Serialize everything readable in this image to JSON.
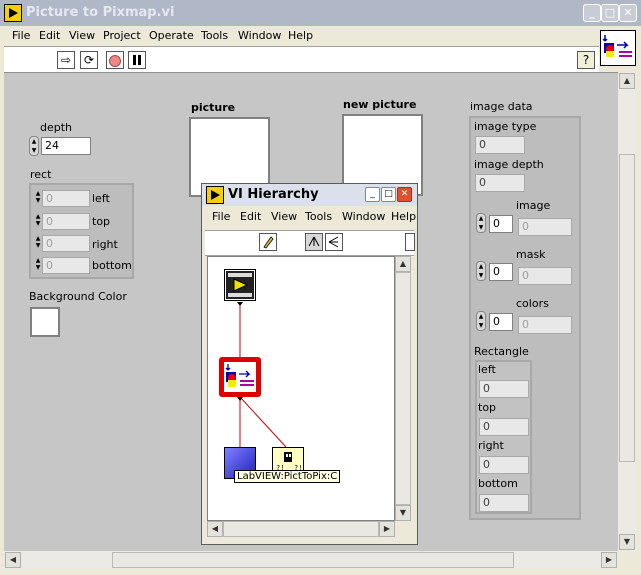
{
  "window": {
    "title": "Picture to Pixmap.vi",
    "minimize": "_",
    "maximize": "□",
    "close": "✕"
  },
  "menu": [
    "File",
    "Edit",
    "View",
    "Project",
    "Operate",
    "Tools",
    "Window",
    "Help"
  ],
  "toolbar": {
    "run": "⇨",
    "run_continuous": "⟳",
    "help": "?"
  },
  "front_panel": {
    "depth": {
      "label": "depth",
      "value": "24"
    },
    "rect": {
      "label": "rect",
      "fields": [
        {
          "label": "left",
          "value": "0"
        },
        {
          "label": "top",
          "value": "0"
        },
        {
          "label": "right",
          "value": "0"
        },
        {
          "label": "bottom",
          "value": "0"
        }
      ]
    },
    "background_color": {
      "label": "Background Color"
    },
    "picture": {
      "label": "picture"
    },
    "new_picture": {
      "label": "new picture"
    },
    "image_data": {
      "label": "image data",
      "image_type": {
        "label": "image type",
        "value": "0"
      },
      "image_depth": {
        "label": "image depth",
        "value": "0"
      },
      "image": {
        "label": "image",
        "index": "0",
        "value": "0"
      },
      "mask": {
        "label": "mask",
        "index": "0",
        "value": "0"
      },
      "colors": {
        "label": "colors",
        "index": "0",
        "value": "0"
      },
      "rectangle": {
        "label": "Rectangle",
        "fields": [
          {
            "label": "left",
            "value": "0"
          },
          {
            "label": "top",
            "value": "0"
          },
          {
            "label": "right",
            "value": "0"
          },
          {
            "label": "bottom",
            "value": "0"
          }
        ]
      }
    }
  },
  "hierarchy_window": {
    "title": "VI Hierarchy",
    "menu": [
      "File",
      "Edit",
      "View",
      "Tools",
      "Window",
      "Help"
    ],
    "tooltip": "LabVIEW:PictToPix:C"
  }
}
